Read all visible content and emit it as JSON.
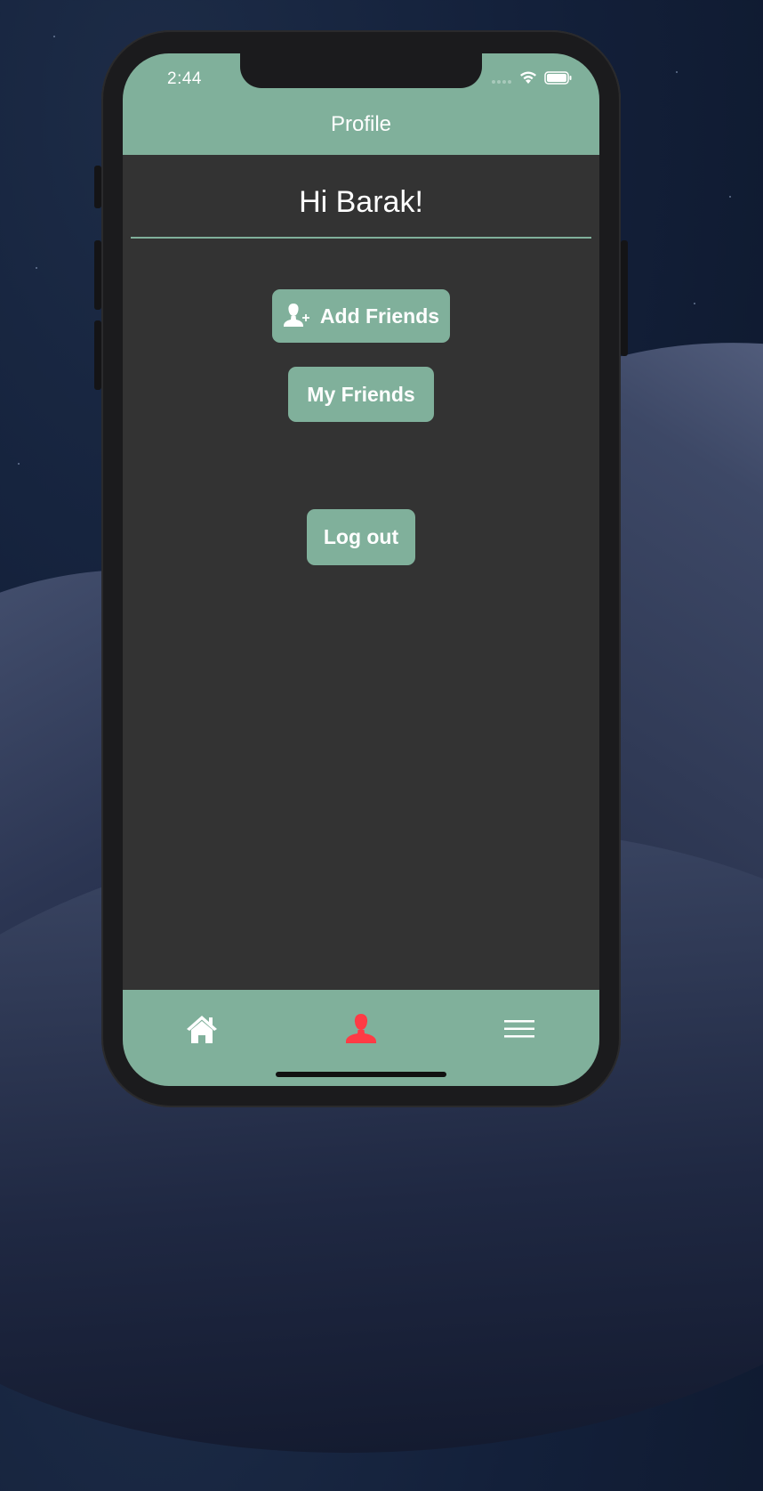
{
  "status_bar": {
    "time": "2:44",
    "icons": [
      "signal-dots-icon",
      "wifi-icon",
      "battery-icon"
    ]
  },
  "header": {
    "title": "Profile"
  },
  "main": {
    "greeting": "Hi Barak!",
    "add_friends_label": "Add Friends",
    "add_friends_icon": "user-plus-icon",
    "my_friends_label": "My Friends",
    "logout_label": "Log out"
  },
  "tab_bar": {
    "items": [
      {
        "name": "home",
        "icon": "home-icon",
        "active": false
      },
      {
        "name": "profile",
        "icon": "user-icon",
        "active": true
      },
      {
        "name": "menu",
        "icon": "hamburger-menu-icon",
        "active": false
      }
    ]
  },
  "colors": {
    "accent": "#80b09b",
    "background": "#333333",
    "active_tab": "#ff3b45",
    "text": "#ffffff"
  }
}
